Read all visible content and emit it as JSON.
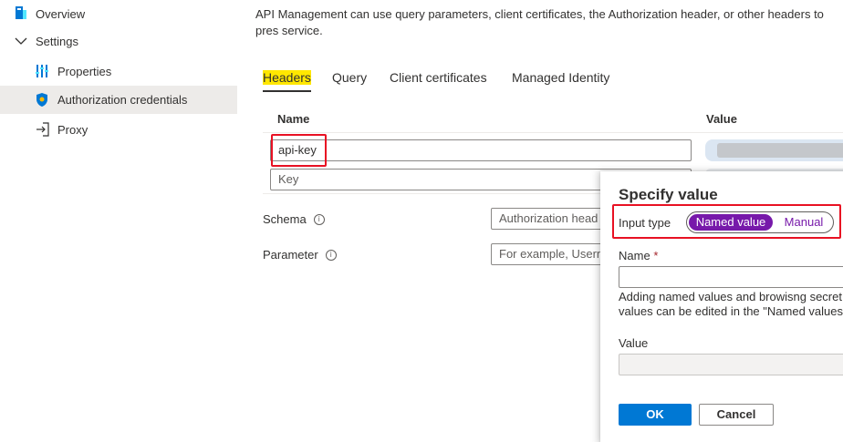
{
  "sidebar": {
    "items": [
      {
        "label": "Overview",
        "icon": "overview-icon"
      },
      {
        "label": "Settings",
        "icon": "chevron-down-icon"
      },
      {
        "label": "Properties",
        "icon": "properties-icon"
      },
      {
        "label": "Authorization credentials",
        "icon": "shield-icon"
      },
      {
        "label": "Proxy",
        "icon": "proxy-icon"
      }
    ]
  },
  "main": {
    "intro": "API Management can use query parameters, client certificates, the Authorization header, or other headers to pres service.",
    "tabs": [
      {
        "label": "Headers"
      },
      {
        "label": "Query"
      },
      {
        "label": "Client certificates"
      },
      {
        "label": "Managed Identity"
      }
    ],
    "table": {
      "headers": [
        "Name",
        "Value"
      ],
      "rows": [
        {
          "name": "api-key"
        }
      ],
      "new_key_placeholder": "Key"
    },
    "schema": {
      "label": "Schema",
      "placeholder": "Authorization head"
    },
    "parameter": {
      "label": "Parameter",
      "placeholder": "For example, Userna"
    }
  },
  "panel": {
    "title": "Specify value",
    "input_type_label": "Input type",
    "options": [
      "Named value",
      "Manual"
    ],
    "selected": "Named value",
    "name_label": "Name",
    "required_mark": "*",
    "help_line1": "Adding named values and browisng secret",
    "help_line2": "values can be edited in the \"Named values\"",
    "value_label": "Value",
    "ok_label": "OK",
    "cancel_label": "Cancel"
  },
  "colors": {
    "accent": "#0078d4",
    "toggle": "#7719aa",
    "highlight_box": "#e81123",
    "tab_highlight": "#ffe700"
  }
}
